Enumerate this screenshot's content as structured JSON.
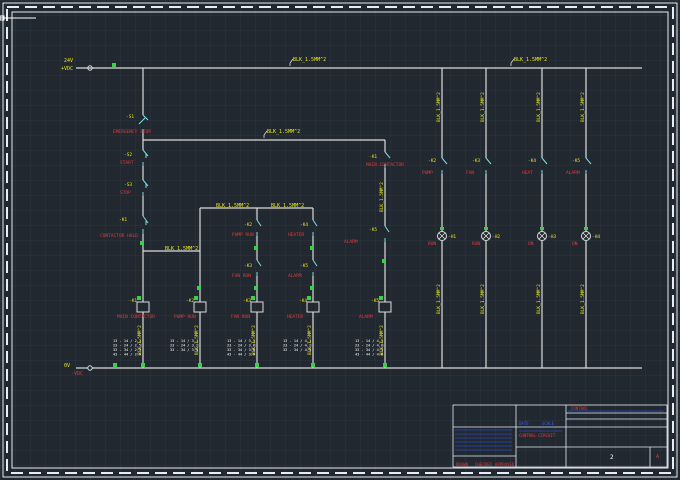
{
  "colors": {
    "background": "#212830",
    "grid": "#2c3440",
    "frame": "#e7ebf4",
    "wire": "#dcdcdc",
    "contact": "#7be0e0",
    "wire_label": "#e6e61a",
    "component_label": "#e03a3a",
    "title_block": "#e7ebf4",
    "title_accent": "#3658ff",
    "terminal_green": "#39d14a"
  },
  "wire_labels": {
    "main_bus": "BLK_1.5MM^2",
    "right_bus": "BLK_1.5MM^2",
    "mid_bus": "BLK_1.5MM^2",
    "group_a": "BLK_1.5MM^2",
    "group_b": "BLK_1.5MM^2",
    "coil_bus": "BLK_1.5MM^2"
  },
  "supply": {
    "top_label": "24V",
    "top_sublabel": "+VDC",
    "bottom_label": "0V",
    "bottom_sublabel": "-VDC"
  },
  "left_column": {
    "estop_tag": "-S1",
    "estop_name": "EMERGENCY STOP",
    "start_tag": "-S2",
    "start_name": "START",
    "stop_tag": "-S3",
    "stop_name": "STOP",
    "relay_contact_tag": "-K1",
    "relay_contact_name": "CONTACTOR HOLD"
  },
  "coils": [
    {
      "tag": "-K1",
      "name": "MAIN CONTACTOR"
    },
    {
      "tag": "-K2",
      "name": "PUMP RUN"
    },
    {
      "tag": "-K3",
      "name": "FAN RUN"
    },
    {
      "tag": "-K4",
      "name": "HEATER"
    },
    {
      "tag": "-K5",
      "name": "ALARM"
    }
  ],
  "coil_contacts": [
    {
      "lines": [
        "13 - 14 / 2.3",
        "23 - 24 / 2.5",
        "33 - 34 / 2.7",
        "43 - 44 / 2.9"
      ]
    },
    {
      "lines": [
        "13 - 14 / 3.1",
        "23 - 24 / 3.2",
        "33 - 34 / 3.4"
      ]
    },
    {
      "lines": [
        "13 - 14 / 3.5",
        "23 - 24 / 3.6",
        "33 - 34 / 3.8",
        "43 - 44 / 3.9"
      ]
    },
    {
      "lines": [
        "13 - 14 / 4.1",
        "23 - 24 / 4.2",
        "33 - 34 / 4.3"
      ]
    },
    {
      "lines": [
        "13 - 14 / 4.5",
        "23 - 24 / 4.6",
        "33 - 34 / 4.7",
        "43 - 44 / 4.8"
      ]
    }
  ],
  "lamps": [
    {
      "contact_tag": "-K2",
      "contact_name": "PUMP",
      "lamp_tag": "-H1",
      "lamp_name": "RUN"
    },
    {
      "contact_tag": "-K3",
      "contact_name": "FAN",
      "lamp_tag": "-H2",
      "lamp_name": "RUN"
    },
    {
      "contact_tag": "-K4",
      "contact_name": "HEAT",
      "lamp_tag": "-H3",
      "lamp_name": "ON"
    },
    {
      "contact_tag": "-K5",
      "contact_name": "ALARM",
      "lamp_tag": "-H4",
      "lamp_name": "ON"
    }
  ],
  "title_block": {
    "company": "CONTROL",
    "drawing_title": "CONTROL CIRCUIT",
    "drawn_label": "DRAWN",
    "checked_label": "CHECKED",
    "approved_label": "APPROVED",
    "date_label": "DATE",
    "scale_label": "SCALE",
    "sheet_number": "2",
    "revision": "A"
  }
}
